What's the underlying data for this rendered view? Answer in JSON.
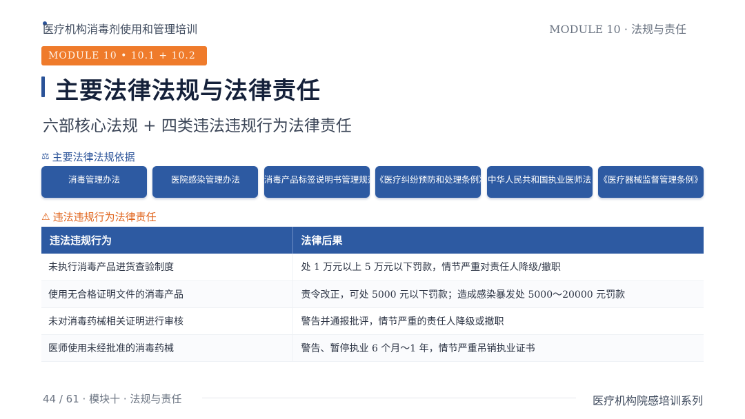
{
  "header": {
    "course_title": "医疗机构消毒剂使用和管理培训",
    "module_label": "MODULE 10 · 法规与责任"
  },
  "badge": "MODULE 10  •  10.1 + 10.2",
  "title": "主要法律法规与法律责任",
  "subtitle": "六部核心法规 + 四类违法违规行为法律责任",
  "laws_section": {
    "icon": "scale-icon",
    "label": "主要法律法规依据",
    "items": [
      "消毒管理办法",
      "医院感染管理办法",
      "消毒产品标签说明书管理规范",
      "《医疗纠纷预防和处理条例》",
      "中华人民共和国执业医师法",
      "《医疗器械监督管理条例》"
    ]
  },
  "violations_section": {
    "icon": "warning-icon",
    "label": "违法违规行为法律责任",
    "headers": [
      "违法违规行为",
      "法律后果"
    ],
    "rows": [
      [
        "未执行消毒产品进货查验制度",
        "处 1 万元以上 5 万元以下罚款，情节严重对责任人降级/撤职"
      ],
      [
        "使用无合格证明文件的消毒产品",
        "责令改正，可处 5000 元以下罚款；造成感染暴发处 5000～20000 元罚款"
      ],
      [
        "未对消毒药械相关证明进行审核",
        "警告并通报批评，情节严重的责任人降级或撤职"
      ],
      [
        "医师使用未经批准的消毒药械",
        "警告、暂停执业 6 个月～1 年，情节严重吊销执业证书"
      ]
    ]
  },
  "footer": {
    "page": "44 / 61 · 模块十 · 法规与责任",
    "series": "医疗机构院感培训系列"
  },
  "colors": {
    "primary": "#2d5aa2",
    "accent": "#ef7b2b",
    "warning": "#e0641c"
  }
}
